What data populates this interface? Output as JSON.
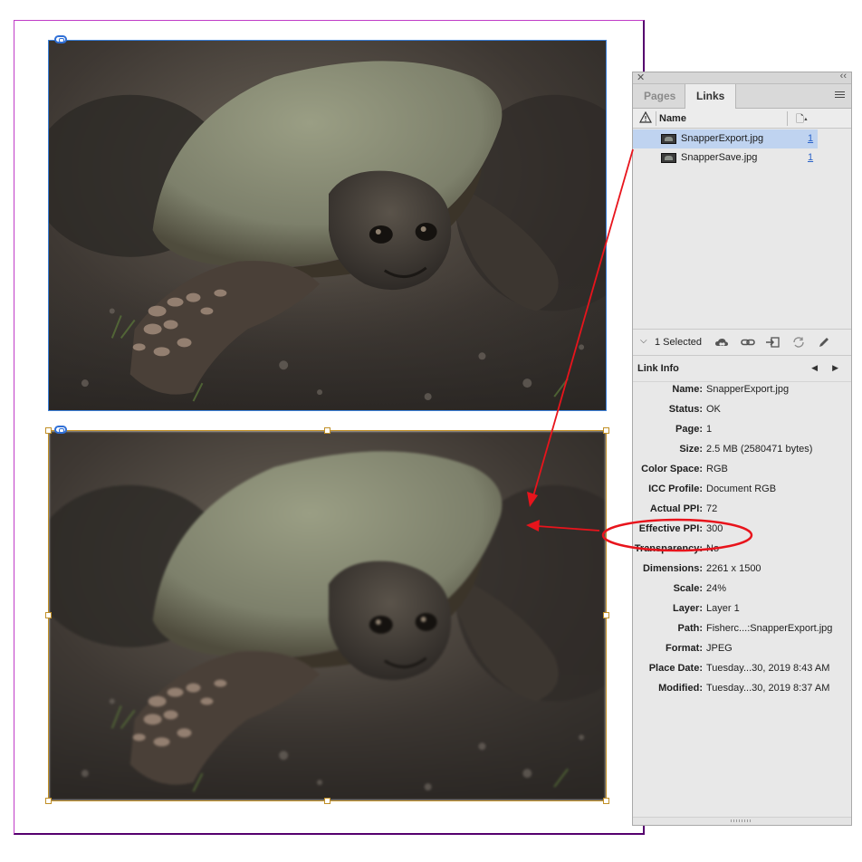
{
  "panel": {
    "tabs": [
      {
        "label": "Pages",
        "active": false
      },
      {
        "label": "Links",
        "active": true
      }
    ],
    "column_name": "Name",
    "links": [
      {
        "name": "SnapperExport.jpg",
        "page": "1",
        "selected": true
      },
      {
        "name": "SnapperSave.jpg",
        "page": "1",
        "selected": false
      }
    ],
    "selection_label": "1 Selected",
    "toolbar_icons": [
      "creative-cloud-icon",
      "relink-icon",
      "goto-link-icon",
      "update-link-icon",
      "edit-original-icon"
    ],
    "link_info": {
      "title": "Link Info",
      "rows": [
        {
          "key": "Name:",
          "value": "SnapperExport.jpg"
        },
        {
          "key": "Status:",
          "value": "OK"
        },
        {
          "key": "Page:",
          "value": "1"
        },
        {
          "key": "Size:",
          "value": "2.5 MB (2580471 bytes)"
        },
        {
          "key": "Color Space:",
          "value": "RGB"
        },
        {
          "key": "ICC Profile:",
          "value": "Document RGB"
        },
        {
          "key": "Actual PPI:",
          "value": "72"
        },
        {
          "key": "Effective PPI:",
          "value": "300"
        },
        {
          "key": "Transparency:",
          "value": "No"
        },
        {
          "key": "Dimensions:",
          "value": "2261 x 1500"
        },
        {
          "key": "Scale:",
          "value": "24%"
        },
        {
          "key": "Layer:",
          "value": "Layer 1"
        },
        {
          "key": "Path:",
          "value": "Fisherc...:SnapperExport.jpg"
        },
        {
          "key": "Format:",
          "value": "JPEG"
        },
        {
          "key": "Place Date:",
          "value": "Tuesday...30, 2019 8:43 AM"
        },
        {
          "key": "Modified:",
          "value": "Tuesday...30, 2019 8:37 AM"
        }
      ]
    }
  },
  "colors": {
    "annotation_red": "#e8141c",
    "selected_frame": "#c18f25",
    "unselected_frame": "#3a7fd8",
    "selected_row": "#bfd3f0"
  }
}
